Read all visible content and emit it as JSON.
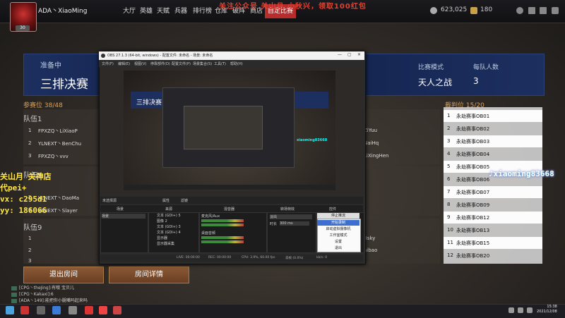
{
  "promo": "关注公众号 关山月 小秋兴，领取100红包",
  "user": {
    "name": "ADA丶XiaoMing",
    "level": "30"
  },
  "nav": [
    "大厅",
    "英雄",
    "天赋",
    "兵器",
    "排行榜",
    "仓库",
    "破阵",
    "商店",
    "自定比赛"
  ],
  "currency": {
    "coins": "623,025",
    "gold": "180"
  },
  "room": {
    "phase": "准备中",
    "title": "三排决赛",
    "mode_label": "比赛模式",
    "mode_value": "天人之战",
    "per_label": "每队人数",
    "per_value": "3"
  },
  "slots_label": "参赛位 38/48",
  "judges_label": "裁判位 15/20",
  "teams": [
    {
      "name": "队伍1",
      "players": [
        {
          "num": "1",
          "name": "FPXZQ丶LiXiaoP",
          "right": "ZiYuu"
        },
        {
          "num": "2",
          "name": "YLNEXT丶BenChu",
          "right": "NaiHq"
        },
        {
          "num": "3",
          "name": "FPXZQ丶vvv",
          "right": "LiXingHen"
        }
      ]
    },
    {
      "name": "队伍5",
      "players": [
        {
          "num": "2",
          "name": "YLNEXT丶DaoMa",
          "right": ""
        },
        {
          "num": "3",
          "name": "YLNEXT丶Slayer",
          "right": ""
        }
      ]
    },
    {
      "name": "队伍9",
      "players": [
        {
          "num": "1",
          "name": "",
          "right": "Bsky"
        },
        {
          "num": "2",
          "name": "",
          "right": "aibao"
        },
        {
          "num": "3",
          "name": "",
          "right": ""
        }
      ]
    }
  ],
  "judges": [
    {
      "num": "1",
      "name": "永劫赛事OB01"
    },
    {
      "num": "2",
      "name": "永劫赛事OB02"
    },
    {
      "num": "3",
      "name": "永劫赛事OB03"
    },
    {
      "num": "4",
      "name": "永劫赛事OB04"
    },
    {
      "num": "5",
      "name": "永劫赛事OB05"
    },
    {
      "num": "6",
      "name": "永劫赛事OB06"
    },
    {
      "num": "7",
      "name": "永劫赛事OB07"
    },
    {
      "num": "8",
      "name": "永劫赛事OB09"
    },
    {
      "num": "9",
      "name": "永劫赛事OB12"
    },
    {
      "num": "10",
      "name": "永劫赛事OB13"
    },
    {
      "num": "11",
      "name": "永劫赛事OB15"
    },
    {
      "num": "12",
      "name": "永劫赛事OB20"
    }
  ],
  "buttons": {
    "leave": "退出房间",
    "details": "房间详情"
  },
  "chat": [
    "[CPG丶theJing]:有哦 宝贝儿",
    "[CPG丶Kakaxi]:6",
    "[ADA丶149]:能把你小腿嘴吗起来吗"
  ],
  "overlay": {
    "line1": "关山月 关神店",
    "line2": "代pei+",
    "line3": "vx: c295d1",
    "line4": "yy: 186066",
    "tiktok": "xiaoming83668"
  },
  "obs": {
    "title": "OBS 27.1.3 (64-bit, windows) - 配置文件: 未命名 - 场景: 未命名",
    "menu": [
      "文件(F)",
      "编辑(E)",
      "视图(V)",
      "停靠部件(D)",
      "配置文件(P)",
      "场景集合(S)",
      "工具(T)",
      "帮助(H)"
    ],
    "scene_label": "未选择源",
    "props": "属性",
    "filters": "滤镜",
    "docks": [
      "场景",
      "来源",
      "混音器",
      "转场特效",
      "控件"
    ],
    "scene_item": "场景",
    "sources": [
      "文本 (GDI+) 5",
      "图像 2",
      "文本 (GDI+) 3",
      "文本 (GDI+) 4",
      "显示器",
      "显示器采集"
    ],
    "mixer": [
      "麦克风/Aux",
      "桌面音频"
    ],
    "transition": {
      "value": "淡出",
      "dur_label": "时长",
      "dur_value": "300 ms"
    },
    "controls": [
      "停止推流",
      "开始录制",
      "启动虚拟摄像机",
      "工作室模式",
      "设置",
      "退出"
    ],
    "status": {
      "live": "LIVE: 00:00:00",
      "rec": "REC: 00:00:00",
      "cpu": "CPU: 3.9%, 60.00 fps",
      "drop": "丢帧 (0.0%)",
      "kbps": "kb/s: 0"
    }
  },
  "clock": {
    "time": "15:38",
    "date": "2021/12/08"
  }
}
